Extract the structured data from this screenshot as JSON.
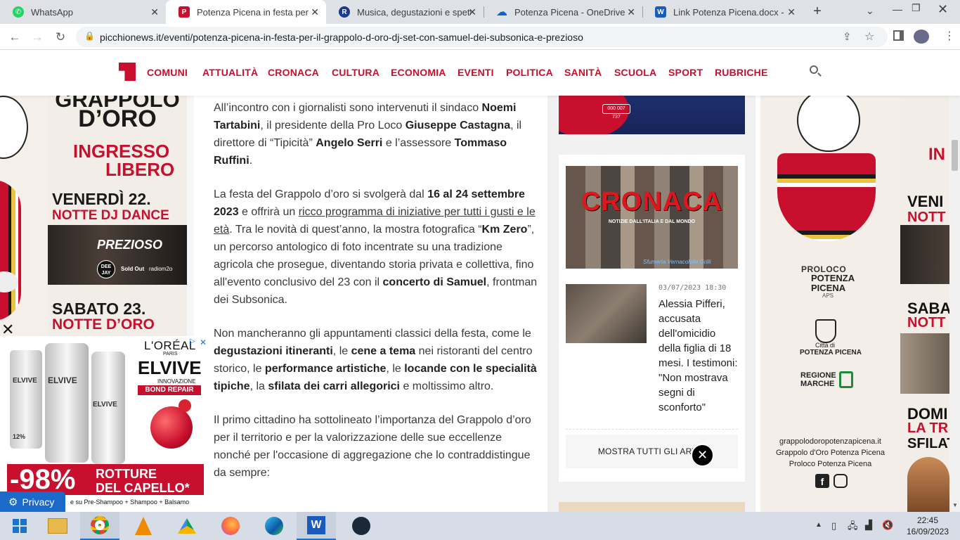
{
  "browser": {
    "tabs": [
      {
        "title": "WhatsApp",
        "icon": "whatsapp-icon",
        "color": "#25d366"
      },
      {
        "title": "Potenza Picena in festa per il G",
        "icon": "picchionews-icon",
        "color": "#c8102e"
      },
      {
        "title": "Musica, degustazioni e spettac",
        "icon": "site-r-icon",
        "color": "#1a3a8a"
      },
      {
        "title": "Potenza Picena - OneDrive",
        "icon": "onedrive-icon",
        "color": "#0a64d6"
      },
      {
        "title": "Link Potenza Picena.docx - Mic",
        "icon": "word-icon",
        "color": "#185abd"
      }
    ],
    "new_tab": "+",
    "url": "picchionews.it/eventi/potenza-picena-in-festa-per-il-grappolo-d-oro-dj-set-con-samuel-dei-subsonica-e-prezioso"
  },
  "site": {
    "nav": [
      "COMUNI",
      "ATTUALITÀ",
      "CRONACA",
      "CULTURA",
      "ECONOMIA",
      "EVENTI",
      "POLITICA",
      "SANITÀ",
      "SCUOLA",
      "SPORT",
      "RUBRICHE"
    ],
    "brand_color": "#c8102e"
  },
  "article": {
    "p1": {
      "t1": " All’incontro con i giornalisti sono intervenuti il sindaco ",
      "b1": "Noemi Tartabini",
      "t2": ", il presidente della Pro Loco ",
      "b2": "Giuseppe Castagna",
      "t3": ", il direttore di “Tipicità” ",
      "b3": "Angelo Serri",
      "t4": " e l’assessore ",
      "b4": "Tommaso Ruffini",
      "t5": "."
    },
    "p2": {
      "t1": "La festa del Grappolo d’oro si svolgerà dal ",
      "b1": "16 al 24 settembre 2023",
      "t2": " e offrirà un ",
      "link": "ricco programma di iniziative per tutti i gusti e le età",
      "t3": ". Tra le novità di quest’anno, la mostra fotografica “",
      "b2": "Km Zero",
      "t4": "”, un percorso antologico di foto incentrate su una tradizione agricola che prosegue, diventando storia privata e collettiva, fino all'evento conclusivo del 23 con il ",
      "b3": "concerto di Samuel",
      "t5": ", frontman dei Subsonica."
    },
    "p3": {
      "t1": "Non mancheranno gli appuntamenti classici della festa, come le ",
      "b1": "degustazioni itineranti",
      "t2": ", le ",
      "b2": "cene a tema",
      "t3": " nei ristoranti del centro storico, le ",
      "b3": "performance artistiche",
      "t4": ", le ",
      "b4": "locande con le specialità tipiche",
      "t5": ", la ",
      "b5": "sfilata dei carri allegorici",
      "t6": " e moltissimo altro."
    },
    "p4": {
      "t1": "Il primo cittadino ha sottolineato l’importanza del Grappolo d’oro per il territorio e per la valorizzazione delle sue eccellenze nonché per l'occasione di aggregazione che lo contraddistingue da sempre:"
    }
  },
  "sidebar": {
    "banner_phone": "000 007 737",
    "cronaca_title": "CRONACA",
    "cronaca_sub": "NOTIZIE DALL'ITALIA E DAL MONDO",
    "cronaca_credit": "Sfumerta Vernacolelle Grilli",
    "news_date": "03/07/2023 18:30",
    "news_title": "Alessia Pifferi, accusata dell'omicidio della figlia di 18 mesi. I testimoni: \"Non mostrava segni di sconforto\"",
    "more_button": "MOSTRA TUTTI GLI ARTIC"
  },
  "left_ad": {
    "line1": "GRAPPOLO",
    "line2": "D’ORO",
    "ingresso": "INGRESSO",
    "libero": "LIBERO",
    "venerdi": "VENERDÌ 22.",
    "notte_dj": "NOTTE DJ DANCE",
    "prezioso": "PREZIOSO",
    "deejay": "DEE JAY",
    "soldout": "Sold Out",
    "radio": "radiom2o",
    "sabato": "SABATO 23.",
    "notte_oro": "NOTTE D’ORO"
  },
  "loreal_ad": {
    "brand": "L'ORÉAL",
    "paris": "PARIS",
    "product": "ELVIVE",
    "innov": "INNOVAZIONE",
    "bond": "BOND REPAIR",
    "percent": "-98%",
    "claim1": "ROTTURE",
    "claim2": "DEL CAPELLO*",
    "footer": "e su Pre-Shampoo + Shampoo + Balsamo",
    "bottle1": "ELVIVE",
    "bottle2": "ELVIVE",
    "bottle3": "ELVIVE",
    "pct12": "12%"
  },
  "privacy": "Privacy",
  "right_ad": {
    "proloco1": "PROLOCO",
    "proloco2": "POTENZA",
    "proloco3": "PICENA",
    "aps": "APS",
    "citta1": "Città di",
    "citta2": "POTENZA PICENA",
    "regione1": "REGIONE",
    "regione2": "MARCHE",
    "site": "grappolodoropotenzapicena.it",
    "fb": "Grappolo d'Oro Potenza Picena",
    "ig": "Proloco Potenza Picena"
  },
  "far_right_ad": {
    "in": "IN",
    "veni": "VENI",
    "nott": "NOTT",
    "saba": "SABA",
    "nott2": "NOTT",
    "domi": "DOMI",
    "latr": "LA TR",
    "sfila": "SFILAT"
  },
  "taskbar": {
    "time": "22:45",
    "date": "16/09/2023"
  }
}
